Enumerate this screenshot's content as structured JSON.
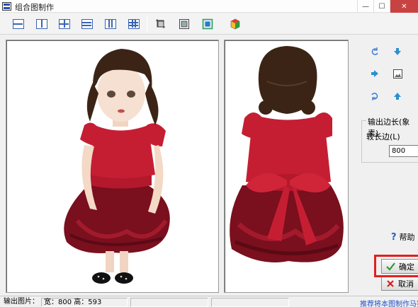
{
  "window": {
    "title": "组合图制作"
  },
  "toolbar": {
    "buttons": [
      {
        "name": "layout-2-rows-icon"
      },
      {
        "name": "layout-2-cols-icon"
      },
      {
        "name": "layout-2x2-icon"
      },
      {
        "name": "layout-3-rows-icon"
      },
      {
        "name": "layout-3-cols-icon"
      },
      {
        "name": "layout-3x3-icon"
      },
      {
        "name": "crop-icon"
      },
      {
        "name": "fit-icon"
      },
      {
        "name": "select-all-icon"
      },
      {
        "name": "color-icon"
      }
    ]
  },
  "output": {
    "legend": "输出边长(象素)",
    "label": "较长边(L)",
    "value": "800"
  },
  "help": {
    "label": "帮助"
  },
  "buttons": {
    "ok": "确定",
    "cancel": "取消"
  },
  "status": {
    "label": "输出图片：",
    "size": "宽：800  高：593",
    "link": "推荐将本图制作马赛克"
  }
}
